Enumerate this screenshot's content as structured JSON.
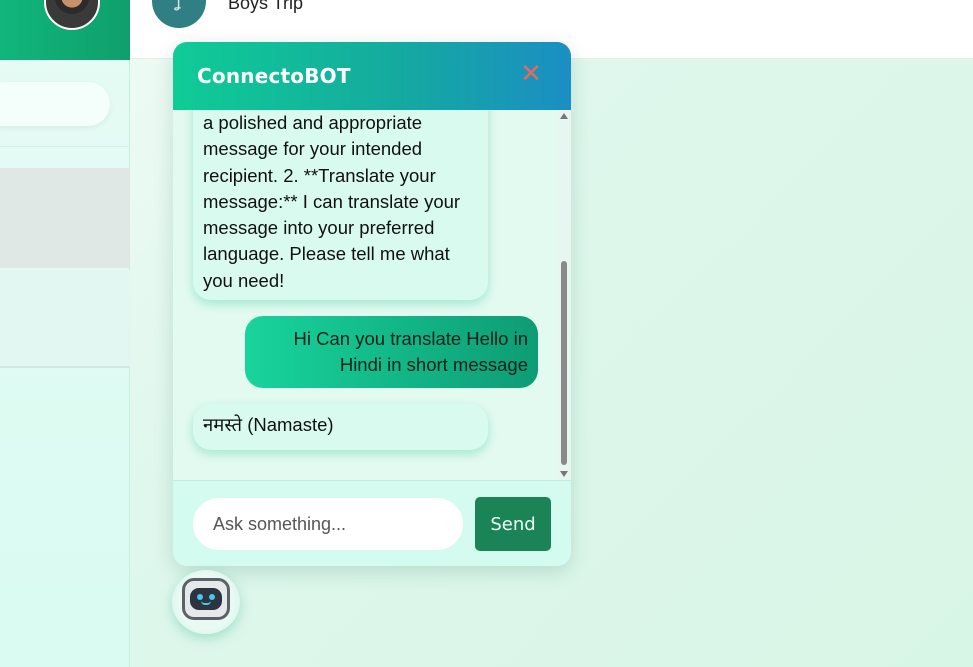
{
  "header": {
    "group_name": "Boys Trip"
  },
  "chat": {
    "title": "ConnectoBOT",
    "close_icon": "close-icon",
    "messages": [
      {
        "sender": "bot",
        "text": "a polished and appropriate message for your intended recipient. 2. **Translate your message:** I can translate your message into your preferred language. Please tell me what you need!"
      },
      {
        "sender": "user",
        "text": "Hi Can you translate Hello in Hindi in short message"
      },
      {
        "sender": "bot",
        "text": "नमस्ते (Namaste)"
      }
    ],
    "input_placeholder": "Ask something...",
    "send_label": "Send"
  },
  "launcher": {
    "icon": "robot-icon"
  },
  "colors": {
    "header_gradient_start": "#0fcc96",
    "header_gradient_end": "#1b8ec4",
    "close": "#e06b5e",
    "send_button": "#1a8456",
    "user_bubble": "#18d49c"
  }
}
